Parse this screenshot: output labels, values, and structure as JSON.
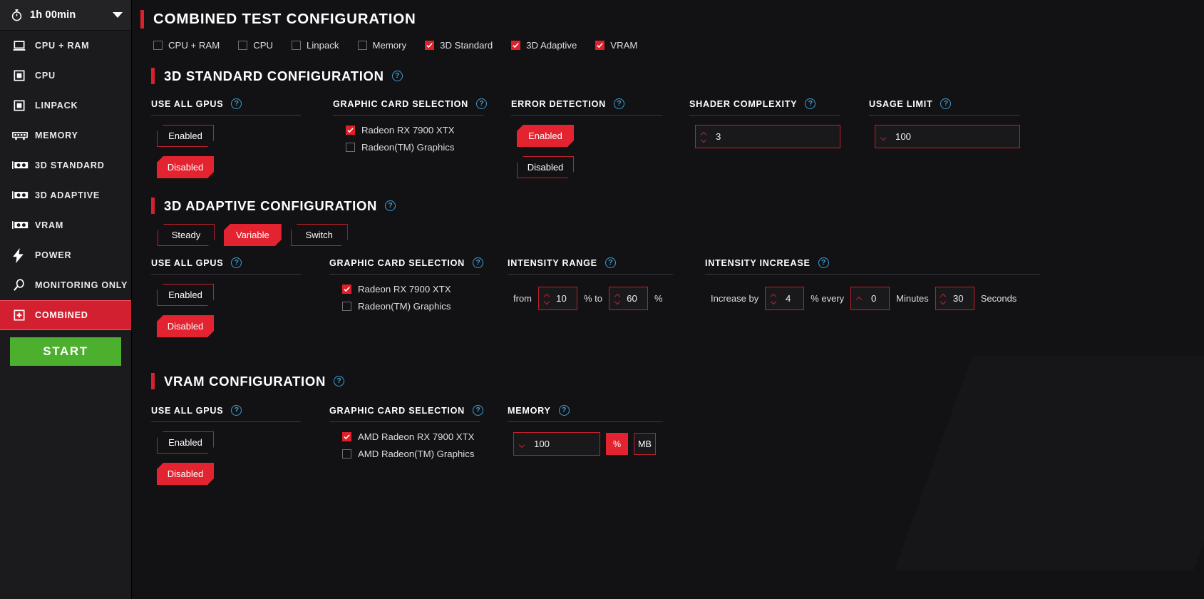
{
  "sidebar": {
    "duration": {
      "icon": "stopwatch-icon",
      "value": "1h 00min",
      "caret": "chevron-down-icon"
    },
    "items": [
      {
        "label": "CPU + RAM",
        "icon": "laptop-icon",
        "active": false
      },
      {
        "label": "CPU",
        "icon": "cpu-chip-icon",
        "active": false
      },
      {
        "label": "LINPACK",
        "icon": "cpu-chip-icon",
        "active": false
      },
      {
        "label": "MEMORY",
        "icon": "ram-stick-icon",
        "active": false
      },
      {
        "label": "3D STANDARD",
        "icon": "gpu-card-icon",
        "active": false
      },
      {
        "label": "3D ADAPTIVE",
        "icon": "gpu-card-icon",
        "active": false
      },
      {
        "label": "VRAM",
        "icon": "gpu-card-icon",
        "active": false
      },
      {
        "label": "POWER",
        "icon": "lightning-bolt-icon",
        "active": false
      },
      {
        "label": "MONITORING ONLY",
        "icon": "magnifier-icon",
        "active": false
      },
      {
        "label": "COMBINED",
        "icon": "plus-square-icon",
        "active": true
      }
    ],
    "start_label": "START"
  },
  "header": {
    "title": "COMBINED TEST CONFIGURATION",
    "tests": [
      {
        "label": "CPU + RAM",
        "checked": false
      },
      {
        "label": "CPU",
        "checked": false
      },
      {
        "label": "Linpack",
        "checked": false
      },
      {
        "label": "Memory",
        "checked": false
      },
      {
        "label": "3D Standard",
        "checked": true
      },
      {
        "label": "3D Adaptive",
        "checked": true
      },
      {
        "label": "VRAM",
        "checked": true
      }
    ]
  },
  "standard": {
    "title": "3D STANDARD CONFIGURATION",
    "use_all_gpus": {
      "title": "USE ALL GPUS",
      "enabled_label": "Enabled",
      "disabled_label": "Disabled",
      "selected": "Disabled"
    },
    "graphic_card": {
      "title": "GRAPHIC CARD SELECTION",
      "cards": [
        {
          "label": "Radeon RX 7900 XTX",
          "checked": true
        },
        {
          "label": "Radeon(TM) Graphics",
          "checked": false
        }
      ]
    },
    "error_detection": {
      "title": "ERROR DETECTION",
      "enabled_label": "Enabled",
      "disabled_label": "Disabled",
      "selected": "Enabled"
    },
    "shader_complexity": {
      "title": "SHADER COMPLEXITY",
      "value": "3"
    },
    "usage_limit": {
      "title": "USAGE LIMIT",
      "value": "100"
    }
  },
  "adaptive": {
    "title": "3D ADAPTIVE CONFIGURATION",
    "modes": [
      {
        "label": "Steady",
        "selected": false
      },
      {
        "label": "Variable",
        "selected": true
      },
      {
        "label": "Switch",
        "selected": false
      }
    ],
    "use_all_gpus": {
      "title": "USE ALL GPUS",
      "enabled_label": "Enabled",
      "disabled_label": "Disabled",
      "selected": "Disabled"
    },
    "graphic_card": {
      "title": "GRAPHIC CARD SELECTION",
      "cards": [
        {
          "label": "Radeon RX 7900 XTX",
          "checked": true
        },
        {
          "label": "Radeon(TM) Graphics",
          "checked": false
        }
      ]
    },
    "intensity_range": {
      "title": "INTENSITY RANGE",
      "from_label": "from",
      "from_value": "10",
      "pct_to_label": "% to",
      "to_value": "60",
      "pct_label": "%"
    },
    "intensity_increase": {
      "title": "INTENSITY INCREASE",
      "increase_by_label": "Increase by",
      "increase_value": "4",
      "every_label": "% every",
      "minutes_value": "0",
      "minutes_label": "Minutes",
      "seconds_value": "30",
      "seconds_label": "Seconds"
    }
  },
  "vram": {
    "title": "VRAM CONFIGURATION",
    "use_all_gpus": {
      "title": "USE ALL GPUS",
      "enabled_label": "Enabled",
      "disabled_label": "Disabled",
      "selected": "Disabled"
    },
    "graphic_card": {
      "title": "GRAPHIC CARD SELECTION",
      "cards": [
        {
          "label": "AMD Radeon RX 7900 XTX",
          "checked": true
        },
        {
          "label": "AMD Radeon(TM) Graphics",
          "checked": false
        }
      ]
    },
    "memory": {
      "title": "MEMORY",
      "value": "100",
      "unit_percent": "%",
      "unit_mb": "MB",
      "selected_unit": "%"
    }
  },
  "colors": {
    "accent_red": "#d9212e",
    "button_red": "#e32430",
    "start_green": "#4caf2e",
    "help_blue": "#3b9fd4",
    "background": "#121214",
    "sidebar": "#1b1b1d"
  },
  "help_glyph": "?"
}
